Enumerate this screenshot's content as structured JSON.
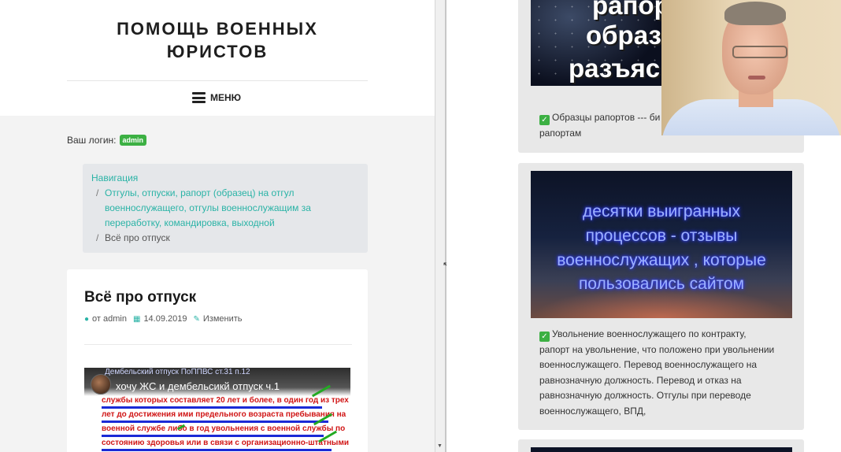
{
  "site": {
    "title_line1": "ПОМОЩЬ ВОЕННЫХ",
    "title_line2": "ЮРИСТОВ",
    "menu_label": "МЕНЮ"
  },
  "login": {
    "label": "Ваш логин:",
    "user": "admin"
  },
  "breadcrumb": {
    "root": "Навигация",
    "category_line1": "Отгулы, отпуски, рапорт (образец) на отгул",
    "category_line2": "военнослужащего, отгулы военнослужащим за",
    "category_line3": "переработку, командировка, выходной",
    "current": "Всё про отпуск",
    "separator": "/"
  },
  "article": {
    "title": "Всё про отпуск",
    "author": "от admin",
    "date": "14.09.2019",
    "edit_label": "Изменить",
    "video": {
      "small_caption": "Дембельский отпуск ПоППВС ст.31 п.12",
      "title": "хочу ЖС и дембельсикй отпуск ч.1",
      "line1": "службы которых составляет 20 лет и более, в один год из трех",
      "line2": "лет до достижения ими предельного возраста пребывания на",
      "line3": "военной службе либо в год увольнения с военной службы по",
      "line4": "состоянию здоровья или в связи с организационно-штатными"
    }
  },
  "sidebar": {
    "widget1": {
      "thumb_line1": "рапор",
      "thumb_line2": "образ",
      "thumb_line3": "разъяс",
      "text_line1": "Образцы рапортов --- би",
      "text_line2": "рапортам"
    },
    "widget2": {
      "thumb_line1": "десятки выигранных",
      "thumb_line2": "процессов - отзывы",
      "thumb_line3": "военнослужащих , которые",
      "thumb_line4": "пользовались сайтом",
      "text_line1": "Увольнение военнослужащего по контракту,",
      "text_line2": "рапорт на увольнение, что положено при увольнении",
      "text_line3": "военнослужащего. Перевод военнослужащего на",
      "text_line4": "равнозначную должность. Перевод и отказ на",
      "text_line5": "равнозначную должность. Отгулы при переводе",
      "text_line6": "военнослужащего, ВПД,"
    }
  },
  "icons": {
    "check": "✓",
    "user": "user-icon",
    "calendar": "calendar-icon",
    "edit": "edit-icon"
  },
  "colors": {
    "accent": "#2ab3a6",
    "badge": "#3cb043"
  }
}
